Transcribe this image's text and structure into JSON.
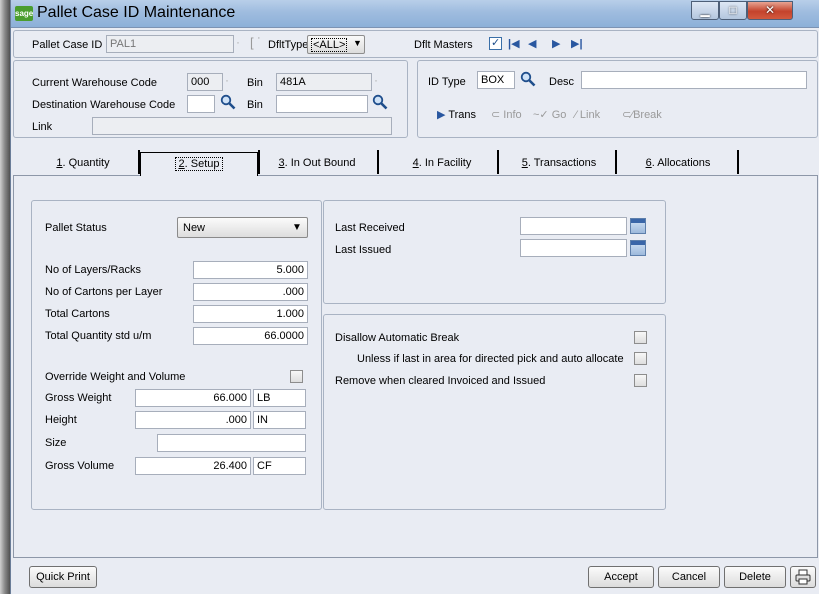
{
  "window": {
    "logo_text": "sage",
    "title": "Pallet Case ID Maintenance"
  },
  "header": {
    "pallet_case_id_label": "Pallet Case ID",
    "pallet_case_id_value": "PAL1",
    "dflt_type_label": "DfltType",
    "dflt_type_value": "<ALL>",
    "dflt_masters_label": "Dflt Masters",
    "dflt_masters_checked": true
  },
  "warehouse": {
    "current_label": "Current Warehouse Code",
    "current_value": "000",
    "bin_label": "Bin",
    "bin_value": "481A",
    "destination_label": "Destination Warehouse Code",
    "destination_value": "",
    "dest_bin_label": "Bin",
    "dest_bin_value": "",
    "link_label": "Link",
    "link_value": ""
  },
  "id_section": {
    "id_type_label": "ID Type",
    "id_type_value": "BOX",
    "desc_label": "Desc",
    "desc_value": "",
    "actions": [
      "Trans",
      "Info",
      "Go",
      "Link",
      "Break"
    ]
  },
  "tabs": [
    {
      "label": "1. Quantity",
      "key": "1",
      "rest": ". Quantity"
    },
    {
      "label": "2. Setup",
      "key": "2",
      "rest": ". Setup"
    },
    {
      "label": "3. In Out Bound",
      "key": "3",
      "rest": ". In Out Bound"
    },
    {
      "label": "4. In Facility",
      "key": "4",
      "rest": ". In Facility"
    },
    {
      "label": "5. Transactions",
      "key": "5",
      "rest": ". Transactions"
    },
    {
      "label": "6. Allocations",
      "key": "6",
      "rest": ". Allocations"
    }
  ],
  "setup": {
    "pallet_status_label": "Pallet Status",
    "pallet_status_value": "New",
    "layers_label": "No of Layers/Racks",
    "layers_value": "5.000",
    "cartons_per_layer_label": "No of Cartons per Layer",
    "cartons_per_layer_value": ".000",
    "total_cartons_label": "Total Cartons",
    "total_cartons_value": "1.000",
    "total_qty_label": "Total Quantity std u/m",
    "total_qty_value": "66.0000",
    "override_label": "Override Weight and Volume",
    "override_checked": false,
    "gross_weight_label": "Gross Weight",
    "gross_weight_value": "66.000",
    "gross_weight_unit": "LB",
    "height_label": "Height",
    "height_value": ".000",
    "height_unit": "IN",
    "size_label": "Size",
    "size_value": "",
    "gross_volume_label": "Gross Volume",
    "gross_volume_value": "26.400",
    "gross_volume_unit": "CF",
    "last_received_label": "Last Received",
    "last_received_value": "",
    "last_issued_label": "Last Issued",
    "last_issued_value": "",
    "disallow_break_label": "Disallow Automatic Break",
    "unless_last_label": "Unless if last in area for directed pick and auto allocate",
    "remove_when_label": "Remove when cleared Invoiced and Issued"
  },
  "footer": {
    "quick_print_label": "Quick Print",
    "accept_label": "Accept",
    "cancel_label": "Cancel",
    "delete_label": "Delete"
  }
}
